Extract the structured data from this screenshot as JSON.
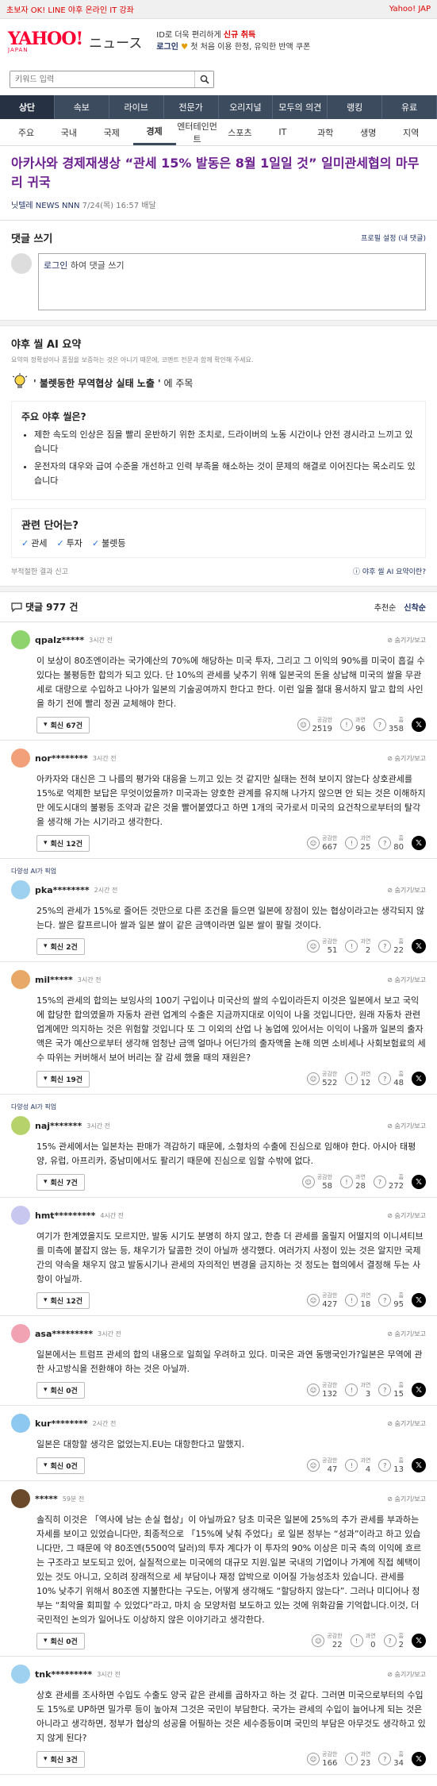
{
  "topbar": {
    "left": "초보자 OK! LINE 야후 온라인 IT 강좌",
    "right": "Yahoo! JAP"
  },
  "header": {
    "logo_main": "YAHOO!",
    "logo_sub": "JAPAN",
    "site": "ニュース",
    "promo_line1_a": "ID로 더욱 편리하게",
    "promo_line1_b": "신규 취득",
    "promo_line2_a": "로그인",
    "promo_line2_b": "첫 처음 이용 한정, 유익한 반액 쿠폰"
  },
  "search": {
    "placeholder": "키워드 입력"
  },
  "gnav": [
    "상단",
    "속보",
    "라이브",
    "전문가",
    "오리지널",
    "모두의 의견",
    "랭킹",
    "유료"
  ],
  "snav": [
    "주요",
    "국내",
    "국제",
    "경제",
    "엔터테인먼트",
    "스포츠",
    "IT",
    "과학",
    "생명",
    "지역"
  ],
  "article": {
    "title": "아카사와 경제재생상 “관세 15% 발동은 8월 1일일 것” 일미관세협의 마무리 귀국",
    "source": "닛텔레 NEWS NNN",
    "date": "7/24(목) 16:57 배달"
  },
  "comment_write": {
    "heading": "댓글 쓰기",
    "profile_link": "프로필 설정 (내 댓글)",
    "login": "로그인",
    "prompt": " 하여 댓글 쓰기"
  },
  "ai_summary": {
    "heading": "야후 씰 AI 요약",
    "note": "요약의 정확성이나 품질을 보증하는 것은 아니기 때문에, 코멘트 전문과 함께 확인해 주세요.",
    "focus_bold": "' 불렛동한 무역협상 실태 노출 '",
    "focus_rest": " 에 주목",
    "points_heading": "주요 야후 씰은?",
    "points": [
      "제한 속도의 인상은 짐을 빨리 운반하기 위한 조치로, 드라이버의 노동 시간이나 안전 경시라고 느끼고 있습니다",
      "운전자의 대우와 급여 수준을 개선하고 인력 부족을 해소하는 것이 문제의 해결로 이어진다는 목소리도 있습니다"
    ],
    "kw_heading": "관련 단어는?",
    "keywords": [
      "관세",
      "투자",
      "불렛등"
    ],
    "report": "부적절한 결과 신고",
    "what": "야후 씰 AI 요약이란?"
  },
  "comments_header": {
    "label": "댓글",
    "count": "977 건",
    "sort_recommend": "추천순",
    "sort_new": "신착순"
  },
  "labels": {
    "likes": "공감한",
    "prop": "과연",
    "hmm": "흠",
    "hide": "숨기기/보고",
    "ai_tag": "다양성 AI가 픽업"
  },
  "comments": [
    {
      "user": "qpalz*****",
      "time": "3시간 전",
      "ai": false,
      "color": "#8fd36f",
      "text": "이 보상이 80조엔이라는 국가예산의 70%에 해당하는 미국 투자, 그리고 그 이익의 90%를 미국이 흡길 수 있다는 불평등한 합의가 되고 있다. 단 10%의 관세를 낮추기 위해 일본국의 돈을 상납해 미국의 쌀을 무관세로 대량으로 수입하고 나아가 일본의 기술공여까지 한다고 한다. 이런 일을 절대 용서하지 말고 합의 사인을 하기 전에 빨리 정권 교체해야 한다.",
      "replies": "회신 67건",
      "likes": "2519",
      "prop": "96",
      "hmm": "358"
    },
    {
      "user": "nor********",
      "time": "3시간 전",
      "ai": false,
      "color": "#f2a079",
      "text": "아카자와 대신은 그 나름의 평가와 대응을 느끼고 있는 것 같지만 실태는 전혀 보이지 않는다 상호관세를 15%로 억제한 보답은 무엇이었을까? 미국과는 양호한 관계를 유지해 나가지 않으면 안 되는 것은 이해하지만 에도시대의 불평등 조약과 같은 것을 빨어붙였다고 하면 1개의 국가로서 미국의 요건착으로부터의 탈각을 생각해 가는 시기라고 생각한다.",
      "replies": "회신 12건",
      "likes": "667",
      "prop": "25",
      "hmm": "80"
    },
    {
      "user": "pka********",
      "time": "2시간 전",
      "ai": true,
      "color": "#9ed0f0",
      "text": "25%의 관세가 15%로 줄어든 것만으로 다른 조건을 들으면 일본에 장점이 있는 협상이라고는 생각되지 않는다. 쌀은 칼프르니아 쌀과 일본 쌀이 같은 금액이라면 일본 쌀이 팔릴 것이다.",
      "replies": "회신 2건",
      "likes": "51",
      "prop": "2",
      "hmm": "22"
    },
    {
      "user": "mil*****",
      "time": "3시간 전",
      "ai": false,
      "color": "#e8a868",
      "text": "15%의 관세의 합의는 보잉사의 100기 구입이나 미국산의 쌀의 수입이라든지 이것은 일본에서 보고 국익에 합당한 합의였을까 자동차 관련 업계의 수출은 지금까지대로 이익이 나올 것입니다만, 원래 자동차 관련 업계에만 의지하는 것은 위험할 것입니다 또 그 이외의 산업 나 농업에 있어서는 이익이 나올까 일본의 출자액은 국가 예산으로부터 생각해 엄청난 금액 얼마나 어딘가의 출자액을 논해 의면 소비세나 사회보험료의 세수 따위는 커버해서 보어 버리는 잘 감세 했을 때의 재원은?",
      "replies": "회신 19건",
      "likes": "522",
      "prop": "12",
      "hmm": "48"
    },
    {
      "user": "naj*******",
      "time": "3시간 전",
      "ai": true,
      "color": "#b6d36b",
      "text": "15% 관세에서는 일본차는 판매가 격감하기 때문에, 소형차의 수출에 진심으로 임해야 한다. 아시아 태평양, 유럽, 아프리카, 중남미에서도 팔리기 때문에 진심으로 임할 수밖에 없다.",
      "replies": "회신 7건",
      "likes": "58",
      "prop": "28",
      "hmm": "272"
    },
    {
      "user": "hmt*********",
      "time": "4시간 전",
      "ai": false,
      "color": "#c7c7ef",
      "text": "여기가 한계였을지도 모르지만, 발동 시기도 분명히 하지 않고, 한층 더 관세를 올릴지 어떨지의 이니셔티브를 미측에 붙잡지 않는 등, 채우기가 달콤한 것이 아닐까 생각했다. 여러가지 사정이 있는 것은 알지만 국제간의 약속을 채우지 않고 발동시기나 관세의 자의적인 변경을 금지하는 것 정도는 협의에서 결정해 두는 사항이 아닐까.",
      "replies": "회신 12건",
      "likes": "427",
      "prop": "18",
      "hmm": "95"
    },
    {
      "user": "asa*********",
      "time": "3시간 전",
      "ai": false,
      "color": "#f2a3b3",
      "text": "일본에서는 트럼프 관세의 합의 내용으로 일희일 우려하고 있다. 미국은 과연 동맹국인가?일본은 무역에 관한 사고방식을 전환해야 하는 것은 아닐까.",
      "replies": "회신 0건",
      "likes": "132",
      "prop": "3",
      "hmm": "15"
    },
    {
      "user": "kur********",
      "time": "2시간 전",
      "ai": false,
      "color": "#8cc8f0",
      "text": "일본은 대항할 생각은 없었는지.EU는 대항한다고 말했지.",
      "replies": "회신 0건",
      "likes": "47",
      "prop": "4",
      "hmm": "13"
    },
    {
      "user": "*****",
      "time": "59분 전",
      "ai": false,
      "color": "#6a4a2a",
      "text": "솔직히 이것은 「역사에 남는 손실 협상」이 아닐까요? 당초 미국은 일본에 25%의 추가 관세를 부과하는 자세를 보이고 있었습니다만, 최종적으로 「15%에 낮춰 주었다」로 일본 정부는 “성과”이라고 하고 있습니다만, 그 때문에 약 80조엔(5500억 달러)의 투자 계다가 이 투자의 90% 이상은 미국 측의 이익에 흐르는 구조라고 보도되고 있어, 실질적으로는 미국에의 대규모 지원.일본 국내의 기업이나 가계에 직접 혜택이 있는 것도 아니고, 오히려 장래적으로 세 부담이나 재정 압박으로 이어질 가능성조차 있습니다. 관세를 10% 낮추기 위해서 80조엔 지불한다는 구도는, 어떻게 생각해도 “할당하지 않는다”. 그러나 미디어나 정부는 “최악을 회피할 수 있었다”라고, 마치 승 모양처럼 보도하고 있는 것에 위화감을 기억합니다.이것, 더 국민적인 논의가 일어나도 이상하지 않은 이야기라고 생각한다.",
      "replies": "회신 0건",
      "likes": "22",
      "prop": "0",
      "hmm": "2"
    },
    {
      "user": "tnk*********",
      "time": "3시간 전",
      "ai": false,
      "color": "#9ed0f0",
      "text": "상호 관세를 조사하면 수입도 수출도 양국 같은 관세를 곱하자고 하는 것 같다. 그러면 미국으로부터의 수입도 15%로 UP하면 밀가루 등이 높아져 그것은 국민이 부담한다. 국가는 관세의 수입이 늘어나게 되는 것은 아니라고 생각하면, 정부가 협상의 성공을 어필하는 것은 세수증등이며 국민의 부담은 아무것도 생각하고 있지 않게 된다?",
      "replies": "회신 3건",
      "likes": "166",
      "prop": "23",
      "hmm": "34"
    }
  ]
}
